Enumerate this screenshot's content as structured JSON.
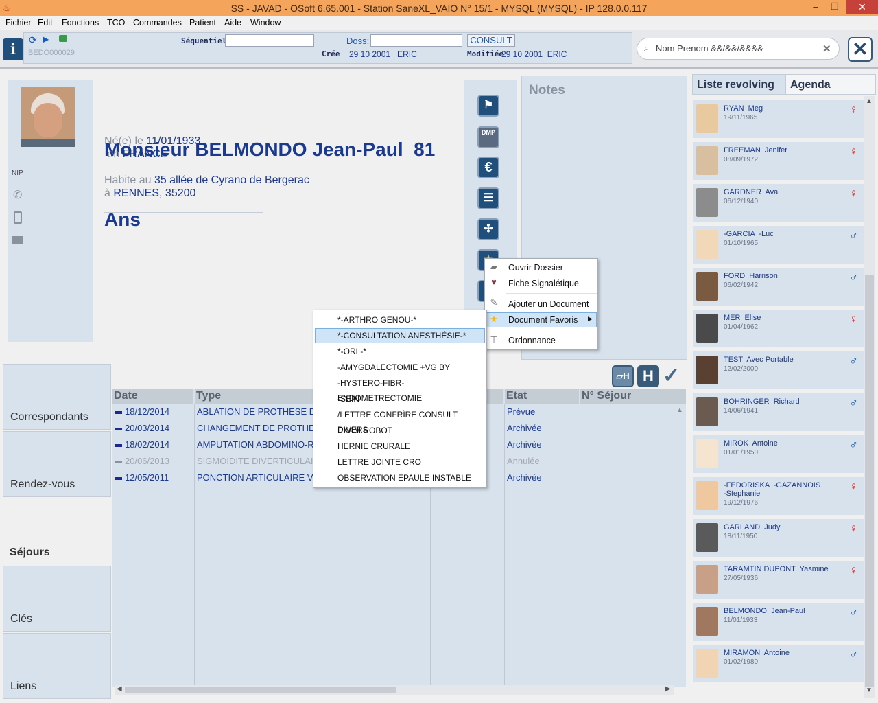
{
  "window": {
    "title": "SS - JAVAD - OSoft 6.65.001 - Station SaneXL_VAIO N° 15/1 - MYSQL (MYSQL) - IP 128.0.0.117"
  },
  "menu": [
    "Fichier",
    "Edit",
    "Fonctions",
    "TCO",
    "Commandes",
    "Patient",
    "Aide",
    "Window"
  ],
  "toolbar": {
    "record_id": "BEDO000029",
    "sequentiel_label": "Séquentiel",
    "sequentiel_value": "",
    "doss_label": "Doss:",
    "doss_value": "",
    "consult_label": "CONSULT",
    "cree_label": "Crée",
    "cree_value": "29 10 2001   ERIC",
    "modifiee_label": "Modifiée",
    "modifiee_value": "29 10 2001  ERIC",
    "search_value": "Nom Prenom &&/&&/&&&&"
  },
  "patient": {
    "name_line1": "Monsieur BELMONDO Jean-Paul  81",
    "name_line2": "Ans",
    "born_prefix": "Né(e) le ",
    "born_date": "11/01/1933",
    "born_in_prefix": " en ",
    "country": "FRANCE",
    "lives_prefix": "Habite au ",
    "address": "35 allée de Cyrano de Bergerac",
    "city_prefix": "à ",
    "city": "RENNES",
    "postal": ", 35200",
    "nip_label": "NIP"
  },
  "side_icons": [
    {
      "icon": "flag-folder-icon",
      "glyph": "⚑"
    },
    {
      "icon": "dmp-icon",
      "glyph": "DMP"
    },
    {
      "icon": "euro-icon",
      "glyph": "€"
    },
    {
      "icon": "id-card-icon",
      "glyph": "☰"
    },
    {
      "icon": "accessibility-icon",
      "glyph": "✣"
    },
    {
      "icon": "star-icon",
      "glyph": "★"
    },
    {
      "icon": "document-icon",
      "glyph": "▌"
    }
  ],
  "notes": {
    "title": "Notes"
  },
  "context_menu": {
    "items": [
      "Ouvrir Dossier",
      "Fiche Signalétique",
      "Ajouter un Document",
      "Document Favoris",
      "Ordonnance"
    ]
  },
  "favoris_menu": {
    "items": [
      "*-ARTHRO GENOU-*",
      "*-CONSULTATION ANESTHÉSIE-*",
      "*-ORL-*",
      "-AMYGDALECTOMIE +VG BY",
      "-HYSTERO-FIBR-ENDOMETRECTOMIE",
      "-SEIN",
      "/LETTRE CONFRÌRE CONSULT DIVERS",
      "EXAM ROBOT",
      "HERNIE CRURALE",
      "LETTRE JOINTE CRO",
      "OBSERVATION EPAULE INSTABLE"
    ],
    "selected_index": 1
  },
  "nav_tabs": [
    "Correspondants",
    "Rendez-vous",
    "Séjours",
    "Clés",
    "Liens"
  ],
  "grid": {
    "headers": {
      "date": "Date",
      "type": "Type",
      "etat": "Etat",
      "sejour": "N° Séjour"
    },
    "rows": [
      {
        "date": "18/12/2014",
        "type": "ABLATION DE PROTHESE D",
        "etat": "Prévue",
        "dim": false
      },
      {
        "date": "20/03/2014",
        "type": "CHANGEMENT DE PROTHE",
        "etat": "Archivée",
        "dim": false
      },
      {
        "date": "18/02/2014",
        "type": "AMPUTATION ABDOMINO-R",
        "etat": "Archivée",
        "dim": false
      },
      {
        "date": "20/06/2013",
        "type": "SIGMOÏDITE DIVERTICULAIR",
        "etat": "Annulée",
        "dim": true
      },
      {
        "date": "12/05/2011",
        "type": "PONCTION ARTICULAIRE V",
        "etat": "Archivée",
        "dim": false
      }
    ]
  },
  "right_tabs": {
    "revolving": "Liste revolving",
    "agenda": "Agenda"
  },
  "revolving": [
    {
      "name": "RYAN  Meg",
      "date": "19/11/1965",
      "sex": "F",
      "photo": "#e8c9a0"
    },
    {
      "name": "FREEMAN  Jenifer",
      "date": "08/09/1972",
      "sex": "F",
      "photo": "#d8bfa0"
    },
    {
      "name": "GARDNER  Ava",
      "date": "06/12/1940",
      "sex": "F",
      "photo": "#8c8c8c"
    },
    {
      "name": "-GARCIA  -Luc",
      "date": "01/10/1965",
      "sex": "M",
      "photo": "#f0d8b8"
    },
    {
      "name": "FORD  Harrison",
      "date": "06/02/1942",
      "sex": "M",
      "photo": "#7a5a40"
    },
    {
      "name": "MER  Elise",
      "date": "01/04/1962",
      "sex": "F",
      "photo": "#4a4a4a"
    },
    {
      "name": "TEST  Avec Portable",
      "date": "12/02/2000",
      "sex": "M",
      "photo": "#5a4030"
    },
    {
      "name": "BOHRINGER  Richard",
      "date": "14/06/1941",
      "sex": "M",
      "photo": "#6a5a50"
    },
    {
      "name": "MIROK  Antoine",
      "date": "01/01/1950",
      "sex": "M",
      "photo": "#f4e4d0"
    },
    {
      "name": "-FEDORISKA  -GAZANNOIS\n-Stephanie",
      "date": "19/12/1976",
      "sex": "F",
      "photo": "#f0c8a0"
    },
    {
      "name": "GARLAND  Judy",
      "date": "18/11/1950",
      "sex": "F",
      "photo": "#5a5a5a"
    },
    {
      "name": "TARAMTIN DUPONT  Yasmine",
      "date": "27/05/1936",
      "sex": "F",
      "photo": "#c8a088"
    },
    {
      "name": "BELMONDO  Jean-Paul",
      "date": "11/01/1933",
      "sex": "M",
      "photo": "#a07860"
    },
    {
      "name": "MIRAMON  Antoine",
      "date": "01/02/1980",
      "sex": "M",
      "photo": "#f0d4b4"
    }
  ],
  "colors": {
    "female": "#d02020",
    "male": "#1a5ab0",
    "accent": "#1b3a8c"
  }
}
